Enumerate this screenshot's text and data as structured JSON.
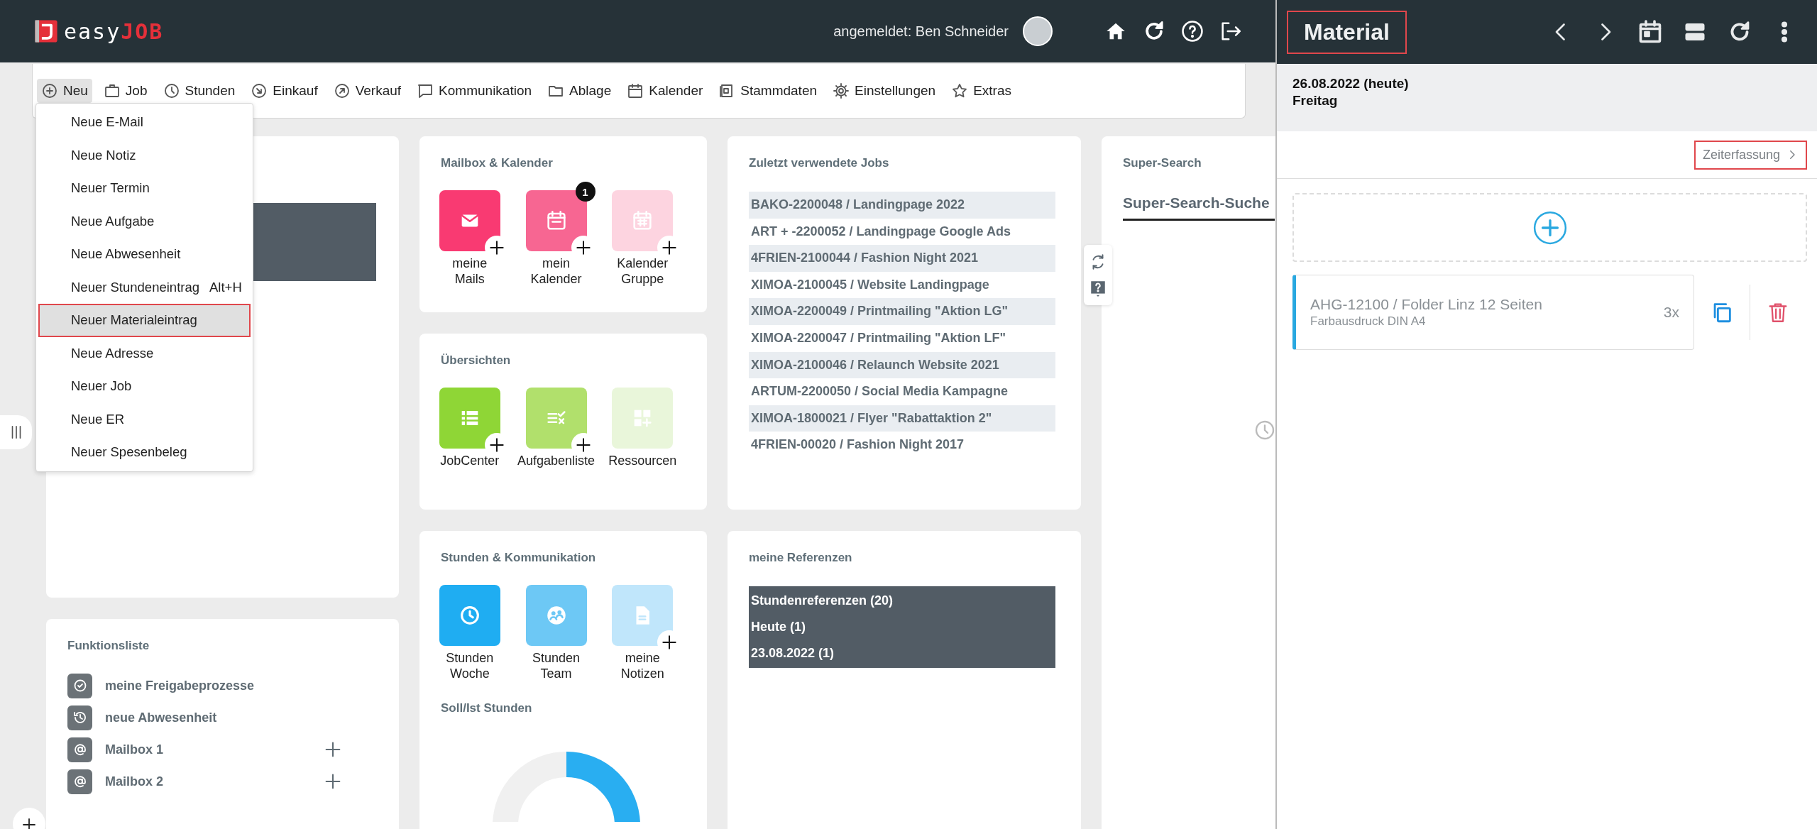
{
  "header": {
    "logo": {
      "prefix": "easy",
      "suffix": "JOB"
    },
    "user_label": "angemeldet: Ben Schneider"
  },
  "toolbar": {
    "items": [
      {
        "label": "Neu",
        "selected": true
      },
      {
        "label": "Job",
        "selected": false
      },
      {
        "label": "Stunden",
        "selected": false
      },
      {
        "label": "Einkauf",
        "selected": false
      },
      {
        "label": "Verkauf",
        "selected": false
      },
      {
        "label": "Kommunikation",
        "selected": false
      },
      {
        "label": "Ablage",
        "selected": false
      },
      {
        "label": "Kalender",
        "selected": false
      },
      {
        "label": "Stammdaten",
        "selected": false
      },
      {
        "label": "Einstellungen",
        "selected": false
      },
      {
        "label": "Extras",
        "selected": false
      }
    ]
  },
  "new_menu": {
    "items": [
      {
        "label": "Neue E-Mail",
        "selected": false
      },
      {
        "label": "Neue Notiz",
        "selected": false
      },
      {
        "label": "Neuer Termin",
        "selected": false
      },
      {
        "label": "Neue Aufgabe",
        "selected": false
      },
      {
        "label": "Neue Abwesenheit",
        "selected": false
      },
      {
        "label": "Neuer Stundeneintrag",
        "shortcut": "Alt+H",
        "selected": false
      },
      {
        "label": "Neuer Materialeintrag",
        "selected": true
      },
      {
        "label": "Neue Adresse",
        "selected": false
      },
      {
        "label": "Neuer Job",
        "selected": false
      },
      {
        "label": "Neue ER",
        "selected": false
      },
      {
        "label": "Neuer Spesenbeleg",
        "selected": false
      }
    ]
  },
  "function_list": {
    "title": "Funktionsliste",
    "items": [
      {
        "label": "meine Freigabeprozesse",
        "add": false
      },
      {
        "label": "neue Abwesenheit",
        "add": false
      },
      {
        "label": "Mailbox 1",
        "add": true
      },
      {
        "label": "Mailbox 2",
        "add": true
      }
    ]
  },
  "mailbox_calendar": {
    "title": "Mailbox & Kalender",
    "tiles": [
      {
        "label": "meine Mails",
        "color": "#f93a72",
        "add": true
      },
      {
        "label": "mein Kalender",
        "color": "#f76692",
        "add": true,
        "badge": "1"
      },
      {
        "label": "Kalender Gruppe",
        "color": "#fdd4e0",
        "add": true
      }
    ]
  },
  "overviews": {
    "title": "Übersichten",
    "tiles": [
      {
        "label": "JobCenter",
        "color": "#8fd636",
        "add": true
      },
      {
        "label": "Aufgabenliste",
        "color": "#b1e06c",
        "add": true
      },
      {
        "label": "Ressourcen",
        "color": "#e9f6da",
        "add": false
      }
    ]
  },
  "hours_communication": {
    "title": "Stunden & Kommunikation",
    "tiles": [
      {
        "label": "Stunden Woche",
        "color": "#1fadf2",
        "add": false
      },
      {
        "label": "Stunden Team",
        "color": "#6dc8f5",
        "add": false
      },
      {
        "label": "meine Notizen",
        "color": "#c0e6fb",
        "add": true
      }
    ],
    "subtitle": "Soll/Ist Stunden"
  },
  "recent_jobs": {
    "title": "Zuletzt verwendete Jobs",
    "rows": [
      "BAKO-2200048 / Landingpage 2022",
      "ART + -2200052 / Landingpage Google Ads",
      "4FRIEN-2100044 / Fashion Night 2021",
      "XIMOA-2100045 / Website Landingpage",
      "XIMOA-2200049 / Printmailing \"Aktion LG\"",
      "XIMOA-2200047 / Printmailing \"Aktion LF\"",
      "XIMOA-2100046 / Relaunch Website 2021",
      "ARTUM-2200050 / Social Media Kampagne",
      "XIMOA-1800021 / Flyer \"Rabattaktion 2\"",
      "4FRIEN-00020 / Fashion Night 2017"
    ]
  },
  "references": {
    "title": "meine Referenzen",
    "rows": [
      "Stundenreferenzen (20)",
      "Heute (1)",
      "23.08.2022 (1)"
    ]
  },
  "super_search": {
    "title": "Super-Search",
    "search": {
      "placeholder": "Super-Search-Suche"
    }
  },
  "material_panel": {
    "title": "Material",
    "title_highlighted": true,
    "date": "26.08.2022 (heute)",
    "weekday": "Freitag",
    "time_link": {
      "label": "Zeiterfassung",
      "highlighted": true
    },
    "entries": [
      {
        "title": "AHG-12100 / Folder Linz 12 Seiten",
        "subtitle": "Farbausdruck DIN A4",
        "quantity": "3x"
      }
    ]
  }
}
